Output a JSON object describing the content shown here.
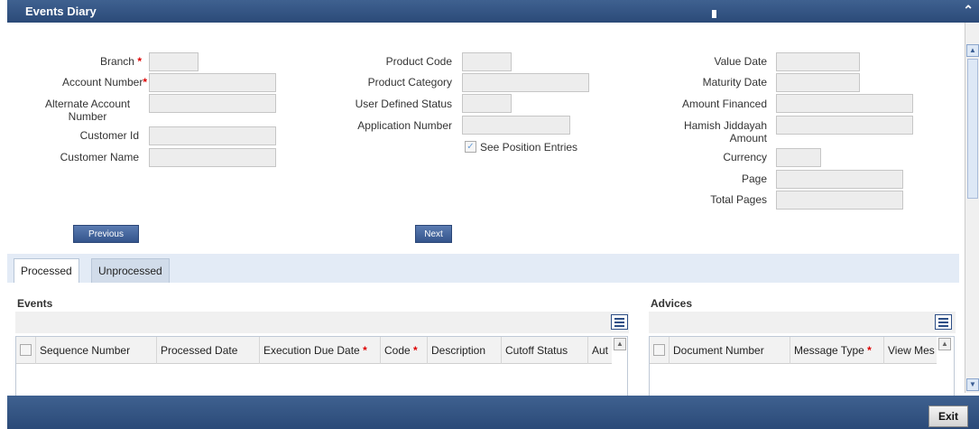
{
  "window": {
    "title": "Events Diary"
  },
  "left_fields": {
    "branch": "Branch",
    "account_number": "Account Number",
    "alternate_account_number": "Alternate Account Number",
    "customer_id": "Customer Id",
    "customer_name": "Customer Name"
  },
  "middle_fields": {
    "product_code": "Product Code",
    "product_category": "Product Category",
    "user_defined_status": "User Defined Status",
    "application_number": "Application Number",
    "see_position_entries": "See Position Entries"
  },
  "right_fields": {
    "value_date": "Value Date",
    "maturity_date": "Maturity Date",
    "amount_financed": "Amount Financed",
    "hamish_jiddayah_amount": "Hamish Jiddayah Amount",
    "currency": "Currency",
    "page": "Page",
    "total_pages": "Total Pages"
  },
  "required_mark": "*",
  "buttons": {
    "previous": "Previous",
    "next": "Next",
    "exit": "Exit"
  },
  "tabs": [
    {
      "label": "Processed",
      "active": true
    },
    {
      "label": "Unprocessed",
      "active": false
    }
  ],
  "events": {
    "title": "Events",
    "columns": [
      "Sequence Number",
      "Processed Date",
      "Execution Due Date",
      "Code",
      "Description",
      "Cutoff Status",
      "Aut"
    ]
  },
  "advices": {
    "title": "Advices",
    "columns": [
      "Document Number",
      "Message Type",
      "View Mes"
    ]
  },
  "icons": {
    "collapse": "chevron-up-icon",
    "grid_settings": "list-settings-icon",
    "checkmark": "checkmark-icon"
  },
  "colors": {
    "header_blue": "#2b4a78",
    "required_red": "#d00000",
    "tab_strip": "#e3ebf6"
  }
}
